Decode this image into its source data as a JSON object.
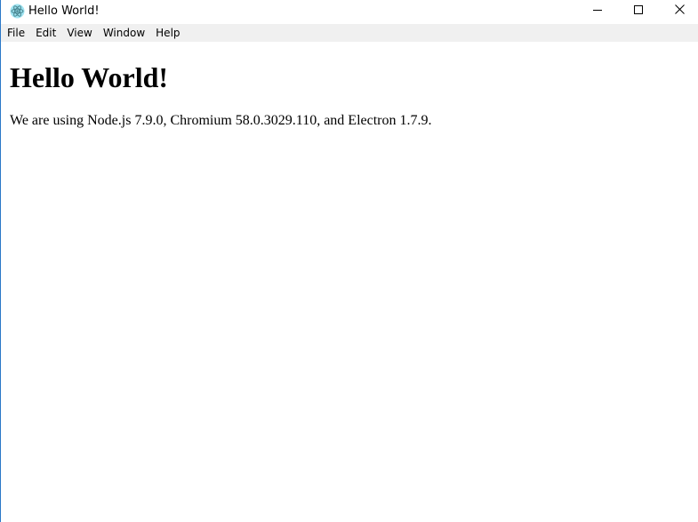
{
  "window": {
    "title": "Hello World!",
    "icon": "electron-icon",
    "controls": [
      "minimize-icon",
      "maximize-icon",
      "close-icon"
    ]
  },
  "menubar": {
    "items": [
      {
        "label": "File"
      },
      {
        "label": "Edit"
      },
      {
        "label": "View"
      },
      {
        "label": "Window"
      },
      {
        "label": "Help"
      }
    ]
  },
  "content": {
    "heading": "Hello World!",
    "body": "We are using Node.js 7.9.0, Chromium 58.0.3029.110, and Electron 1.7.9."
  },
  "colors": {
    "menubar_bg": "#f0f0f0",
    "window_border": "#2b78c8",
    "icon_accent": "#47848f"
  }
}
